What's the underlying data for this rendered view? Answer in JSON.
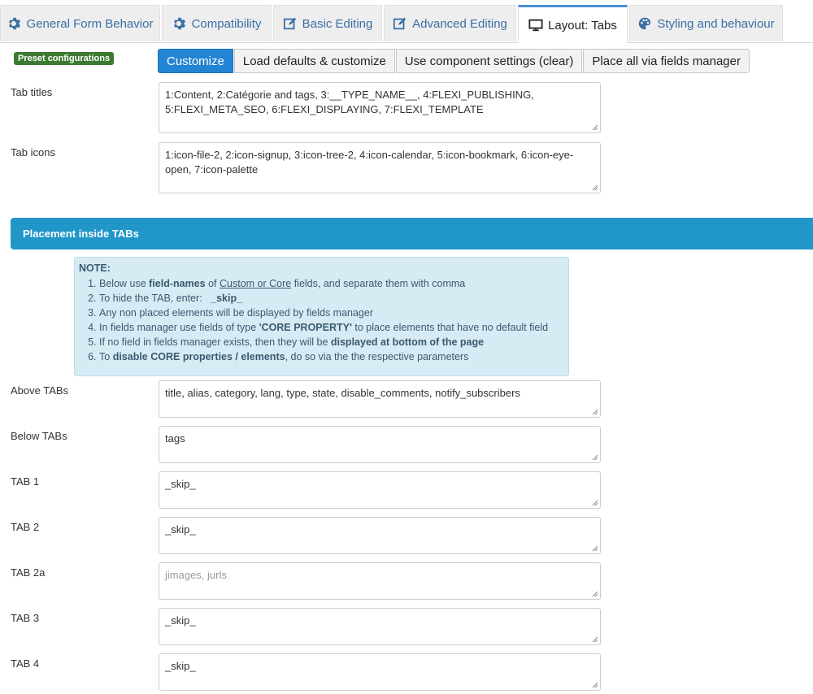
{
  "tabs": [
    {
      "label": "General Form Behavior",
      "icon": "gear-icon"
    },
    {
      "label": "Compatibility",
      "icon": "gear-icon"
    },
    {
      "label": "Basic Editing",
      "icon": "edit-icon"
    },
    {
      "label": "Advanced Editing",
      "icon": "edit-icon"
    },
    {
      "label": "Layout: Tabs",
      "icon": "monitor-icon"
    },
    {
      "label": "Styling and behaviour",
      "icon": "palette-icon"
    }
  ],
  "preset": {
    "badge": "Preset configurations",
    "buttons": [
      "Customize",
      "Load defaults & customize",
      "Use component settings (clear)",
      "Place all via fields manager"
    ]
  },
  "fields": {
    "tab_titles": {
      "label": "Tab titles",
      "value": "1:Content, 2:Catégorie and tags, 3:__TYPE_NAME__, 4:FLEXI_PUBLISHING, 5:FLEXI_META_SEO, 6:FLEXI_DISPLAYING, 7:FLEXI_TEMPLATE"
    },
    "tab_icons": {
      "label": "Tab icons",
      "value": "1:icon-file-2, 2:icon-signup, 3:icon-tree-2, 4:icon-calendar, 5:icon-bookmark, 6:icon-eye-open, 7:icon-palette"
    }
  },
  "section": {
    "title": "Placement inside TABs"
  },
  "note": {
    "title": "NOTE:",
    "items": [
      {
        "pre": "Below use ",
        "b": "field-names",
        "mid": " of ",
        "u": "Custom or Core",
        "post": " fields, and separate them with comma"
      },
      {
        "pre": "To hide the TAB, enter:   ",
        "b": "_skip_"
      },
      {
        "pre": "Any non placed elements will be displayed by fields manager"
      },
      {
        "pre": "In fields manager use fields of type ",
        "b": "'CORE PROPERTY'",
        "post": " to place elements that have no default field"
      },
      {
        "pre": "If no field in fields manager exists, then they will be ",
        "b": "displayed at bottom of the page"
      },
      {
        "pre": "To ",
        "b": "disable CORE properties / elements",
        "post": ", do so via the the respective parameters"
      }
    ]
  },
  "placements": [
    {
      "label": "Above TABs",
      "value": "title, alias, category, lang, type, state, disable_comments, notify_subscribers",
      "placeholder": false
    },
    {
      "label": "Below TABs",
      "value": "tags",
      "placeholder": false
    },
    {
      "label": "TAB 1",
      "value": "_skip_",
      "placeholder": false
    },
    {
      "label": "TAB 2",
      "value": "_skip_",
      "placeholder": false
    },
    {
      "label": "TAB 2a",
      "value": "jimages, jurls",
      "placeholder": true
    },
    {
      "label": "TAB 3",
      "value": "_skip_",
      "placeholder": false
    },
    {
      "label": "TAB 4",
      "value": "_skip_",
      "placeholder": false
    }
  ]
}
